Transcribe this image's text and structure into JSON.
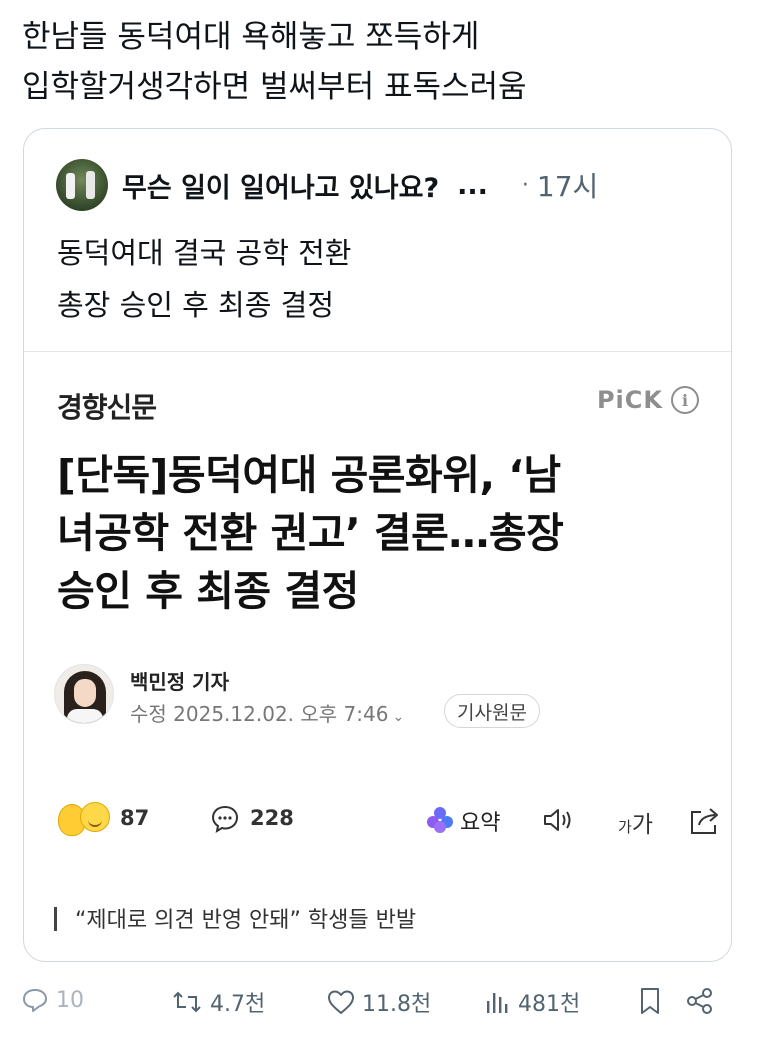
{
  "tweet": {
    "text_line1": "한남들 동덕여대 욕해놓고 쪼득하게",
    "text_line2": "입학할거생각하면 벌써부터 표독스러움"
  },
  "quoted_tweet": {
    "author_name": "무슨 일이 일어나고 있나요?",
    "name_overflow": "...",
    "separator": "·",
    "time": "17시",
    "text_line1": "동덕여대 결국 공학 전환",
    "text_line2": "총장 승인 후 최종 결정"
  },
  "article": {
    "publisher": "경향신문",
    "pick_label": "PiCK",
    "info_icon_glyph": "i",
    "headline_line1": "[단독]동덕여대 공론화위, ‘남",
    "headline_line2": "녀공학 전환 권고’ 결론…총장",
    "headline_line3": "승인 후 최종 결정",
    "reporter": "백민정 기자",
    "edit_time": "수정 2025.12.02. 오후 7:46",
    "original_button": "기사원문",
    "reaction_count": "87",
    "comment_count": "228",
    "summary_label": "요약",
    "font_small": "가",
    "font_big": "가",
    "sub_headline": "“제대로 의견 반영 안돼” 학생들 반발"
  },
  "actions": {
    "replies": "10",
    "retweets": "4.7천",
    "likes": "11.8천",
    "views": "481천"
  },
  "colors": {
    "text_primary": "#0f1419",
    "text_secondary": "#536471",
    "card_border": "#cfd9de"
  }
}
